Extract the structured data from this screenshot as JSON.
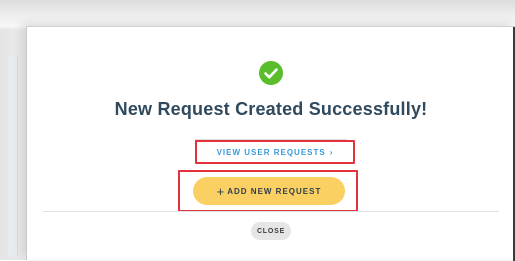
{
  "modal": {
    "icon": "check-circle-icon",
    "title": "New Request Created Successfully!",
    "view_requests_label": "VIEW USER REQUESTS",
    "view_requests_chevron": "›",
    "add_new_plus": "+",
    "add_new_label": "ADD NEW REQUEST",
    "close_label": "CLOSE"
  },
  "colors": {
    "success": "#5bbd2b",
    "title": "#2f4a5e",
    "link": "#3a9ad9",
    "primary_button": "#fbd063",
    "highlight_box": "#e2333c",
    "close_button": "#e6e6e6"
  }
}
